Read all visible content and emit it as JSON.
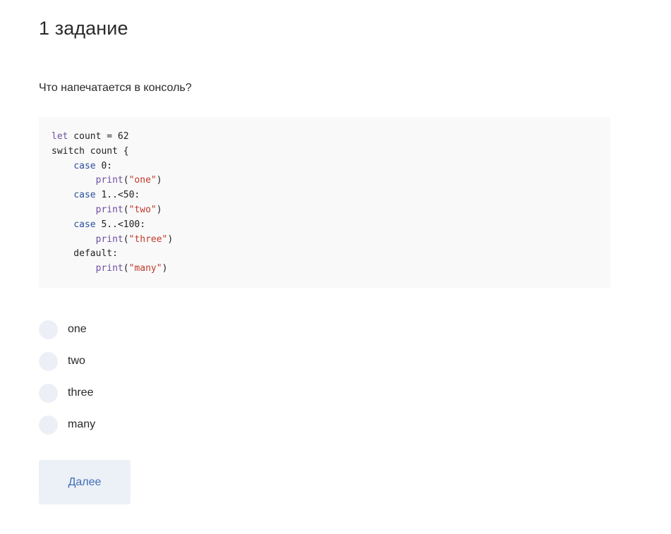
{
  "task": {
    "title": "1 задание",
    "question": "Что напечатается в консоль?"
  },
  "code": {
    "lines": [
      [
        {
          "t": "kw",
          "v": "let"
        },
        {
          "t": "plain",
          "v": " count = 62"
        }
      ],
      [
        {
          "t": "plain",
          "v": "switch count {"
        }
      ],
      [
        {
          "t": "plain",
          "v": "    "
        },
        {
          "t": "case",
          "v": "case"
        },
        {
          "t": "plain",
          "v": " 0:"
        }
      ],
      [
        {
          "t": "plain",
          "v": "        "
        },
        {
          "t": "fn",
          "v": "print"
        },
        {
          "t": "plain",
          "v": "("
        },
        {
          "t": "str",
          "v": "\"one\""
        },
        {
          "t": "plain",
          "v": ")"
        }
      ],
      [
        {
          "t": "plain",
          "v": "    "
        },
        {
          "t": "case",
          "v": "case"
        },
        {
          "t": "plain",
          "v": " 1..<50:"
        }
      ],
      [
        {
          "t": "plain",
          "v": "        "
        },
        {
          "t": "fn",
          "v": "print"
        },
        {
          "t": "plain",
          "v": "("
        },
        {
          "t": "str",
          "v": "\"two\""
        },
        {
          "t": "plain",
          "v": ")"
        }
      ],
      [
        {
          "t": "plain",
          "v": "    "
        },
        {
          "t": "case",
          "v": "case"
        },
        {
          "t": "plain",
          "v": " 5..<100:"
        }
      ],
      [
        {
          "t": "plain",
          "v": "        "
        },
        {
          "t": "fn",
          "v": "print"
        },
        {
          "t": "plain",
          "v": "("
        },
        {
          "t": "str",
          "v": "\"three\""
        },
        {
          "t": "plain",
          "v": ")"
        }
      ],
      [
        {
          "t": "plain",
          "v": "    default:"
        }
      ],
      [
        {
          "t": "plain",
          "v": "        "
        },
        {
          "t": "fn",
          "v": "print"
        },
        {
          "t": "plain",
          "v": "("
        },
        {
          "t": "str",
          "v": "\"many\""
        },
        {
          "t": "plain",
          "v": ")"
        }
      ]
    ]
  },
  "options": [
    {
      "label": "one"
    },
    {
      "label": "two"
    },
    {
      "label": "three"
    },
    {
      "label": "many"
    }
  ],
  "actions": {
    "next_label": "Далее"
  },
  "colors": {
    "keyword": "#6f4fa0",
    "case_keyword": "#2d4f9e",
    "string": "#c0392b",
    "code_background": "#f9f9f9",
    "radio_background": "#ecf0f6",
    "button_background": "#ecf0f7",
    "button_text": "#3f6fb3"
  }
}
